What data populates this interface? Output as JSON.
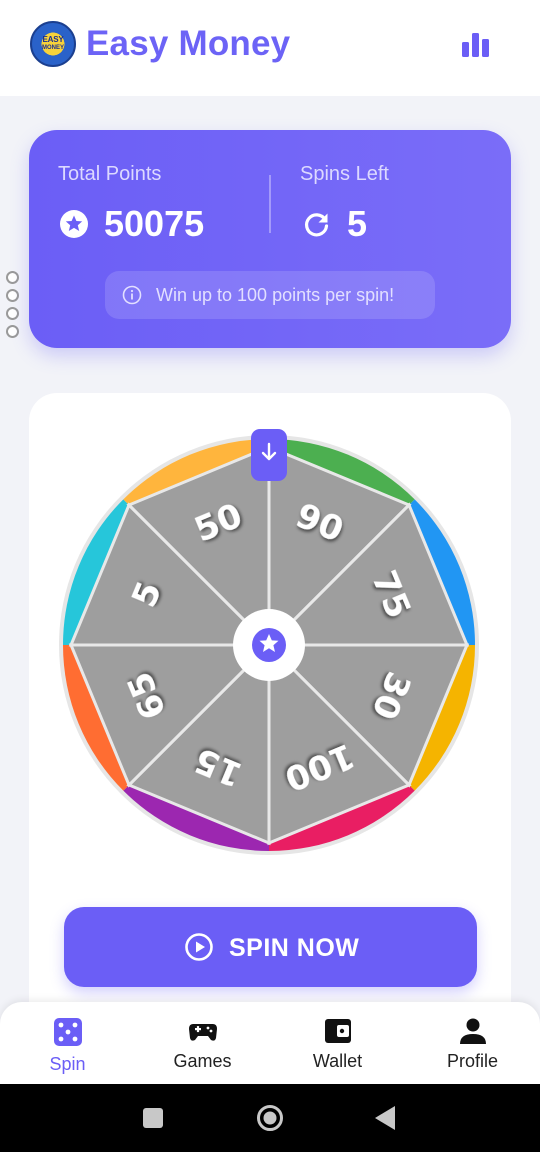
{
  "header": {
    "logo_line1": "EASY",
    "logo_line2": "MONEY",
    "title": "Easy Money",
    "stats_icon": "bar-chart-icon"
  },
  "points_card": {
    "total_label": "Total Points",
    "total_value": "50075",
    "spins_label": "Spins Left",
    "spins_value": "5",
    "info_text": "Win up to 100 points per spin!"
  },
  "wheel": {
    "segments": [
      "90",
      "75",
      "30",
      "100",
      "15",
      "65",
      "5",
      "50"
    ],
    "rim_colors": [
      "#4caf50",
      "#2196f3",
      "#f5b400",
      "#e91e63",
      "#9c27b0",
      "#ff6d32",
      "#26c6da",
      "#ffb53d"
    ],
    "segment_color": "#9e9e9e",
    "pointer_icon": "arrow-down-icon",
    "center_icon": "star-icon"
  },
  "spin_button": {
    "label": "SPIN NOW"
  },
  "nav": {
    "items": [
      {
        "label": "Spin",
        "icon": "dice-icon",
        "active": true
      },
      {
        "label": "Games",
        "icon": "gamepad-icon",
        "active": false
      },
      {
        "label": "Wallet",
        "icon": "wallet-icon",
        "active": false
      },
      {
        "label": "Profile",
        "icon": "person-icon",
        "active": false
      }
    ]
  },
  "colors": {
    "accent": "#6b5ef6",
    "background": "#f2f3f8"
  }
}
